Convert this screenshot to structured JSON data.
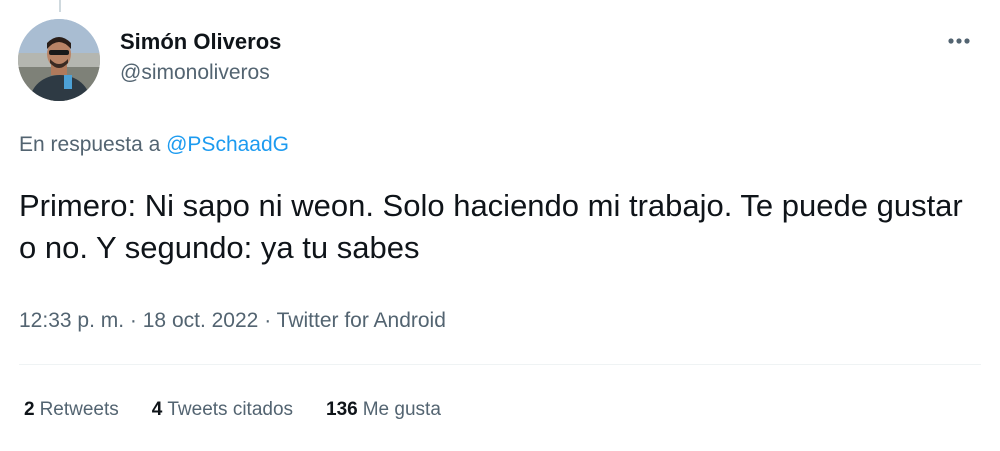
{
  "author": {
    "display_name": "Simón Oliveros",
    "handle": "@simonoliveros",
    "avatar_icon": "user-avatar-photo"
  },
  "menu": {
    "icon": "more-dots-icon"
  },
  "reply": {
    "prefix": "En respuesta a",
    "mention": "@PSchaadG"
  },
  "tweet": {
    "text": "Primero: Ni sapo ni weon. Solo haciendo mi trabajo. Te puede gustar o no. Y segundo: ya tu sabes"
  },
  "meta": {
    "time": "12:33 p. m.",
    "date": "18 oct. 2022",
    "source": "Twitter for Android",
    "separator": "·"
  },
  "stats": {
    "retweets_count": "2",
    "retweets_label": "Retweets",
    "quotes_count": "4",
    "quotes_label": "Tweets citados",
    "likes_count": "136",
    "likes_label": "Me gusta"
  },
  "colors": {
    "accent": "#1d9bf0",
    "text_primary": "#0f1419",
    "text_secondary": "#536471",
    "divider": "#eff3f4"
  }
}
